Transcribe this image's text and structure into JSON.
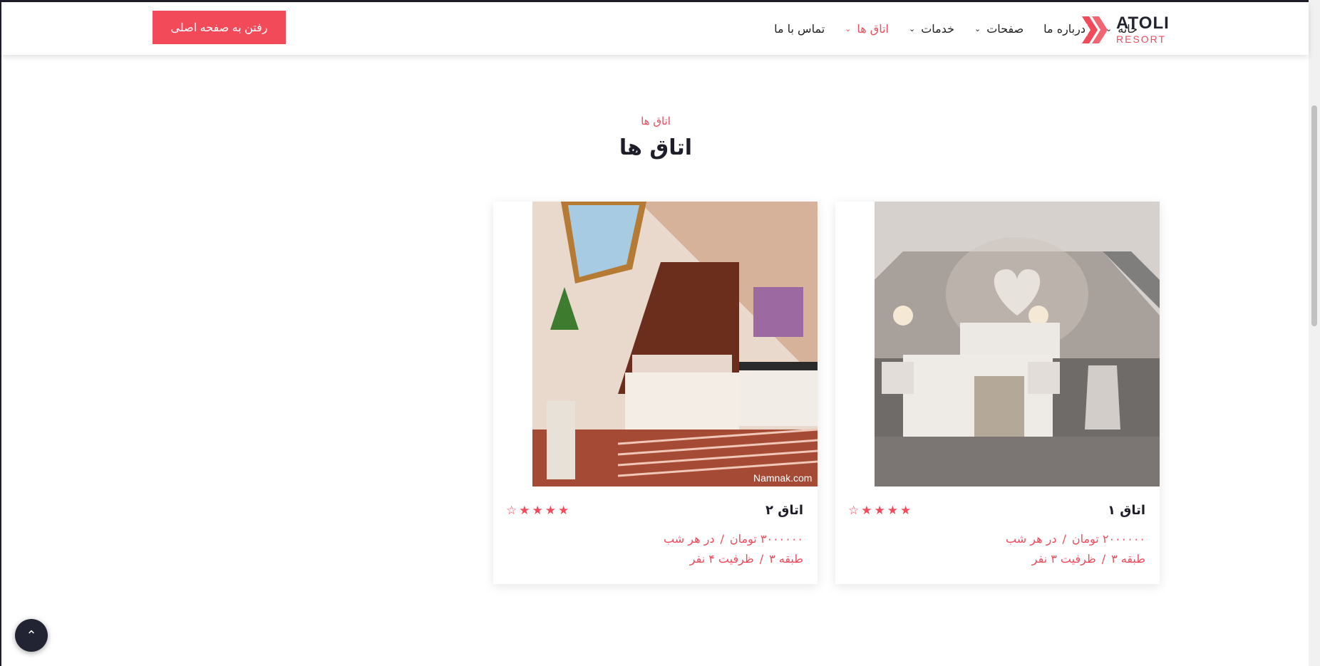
{
  "brand": {
    "name": "ATOLI",
    "tagline": "RESORT",
    "accent": "#f34a5a",
    "dark": "#1e1e2a"
  },
  "nav": {
    "items": [
      {
        "label": "خانه",
        "has_dropdown": true
      },
      {
        "label": "درباره ما",
        "has_dropdown": false
      },
      {
        "label": "صفحات",
        "has_dropdown": true
      },
      {
        "label": "خدمات",
        "has_dropdown": true
      },
      {
        "label": "اتاق ها",
        "has_dropdown": true,
        "active": true
      },
      {
        "label": "تماس با ما",
        "has_dropdown": false
      }
    ],
    "cta_label": "رفتن به صفحه اصلی"
  },
  "section": {
    "subtitle": "اتاق ها",
    "title": "اتاق ها"
  },
  "rooms": [
    {
      "name": "اتاق ۱",
      "price": "۲۰۰۰۰۰۰ تومان",
      "price_unit": "در هر شب",
      "floor": "طبقه ۳",
      "capacity": "ظرفیت ۳ نفر",
      "rating_stars": 4.5
    },
    {
      "name": "اتاق ۲",
      "price": "۳۰۰۰۰۰۰ تومان",
      "price_unit": "در هر شب",
      "floor": "طبقه ۳",
      "capacity": "ظرفیت ۴ نفر",
      "rating_stars": 4.5,
      "image_watermark": "Namnak.com"
    }
  ],
  "icons": {
    "back_to_top": "double-chevron-up-icon",
    "dropdown": "chevron-down-icon",
    "rating": "star-icon"
  }
}
